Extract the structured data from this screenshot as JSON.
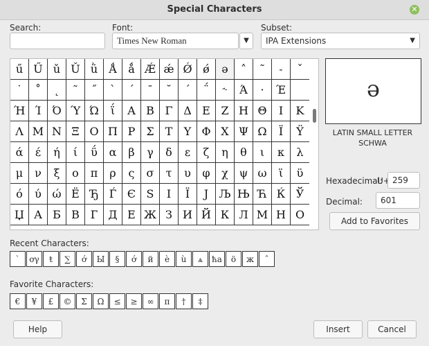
{
  "window": {
    "title": "Special Characters"
  },
  "search": {
    "label": "Search:",
    "value": ""
  },
  "font": {
    "label": "Font:",
    "value": "Times New Roman"
  },
  "subset": {
    "label": "Subset:",
    "value": "IPA Extensions"
  },
  "grid": {
    "cells": [
      "ű",
      "Ű",
      "ǔ",
      "Ǔ",
      "ǜ",
      "Ǻ",
      "ǻ",
      "Ǽ",
      "ǽ",
      "Ǿ",
      "ǿ",
      "ə",
      "˄",
      "˜",
      "˗",
      "ˇ",
      "˙",
      "˚",
      "˛",
      "˜",
      "˝",
      "ˋ",
      "ˊ",
      "ˉ",
      "˘",
      "΄",
      "΅",
      "˞",
      "Ά",
      "·",
      "Έ",
      "",
      "Ή",
      "Ί",
      "Ό",
      "Ύ",
      "Ώ",
      "ΐ",
      "Α",
      "Β",
      "Γ",
      "Δ",
      "Ε",
      "Ζ",
      "Η",
      "Θ",
      "Ι",
      "Κ",
      "Λ",
      "Μ",
      "Ν",
      "Ξ",
      "Ο",
      "Π",
      "Ρ",
      "Σ",
      "Τ",
      "Υ",
      "Φ",
      "Χ",
      "Ψ",
      "Ω",
      "Ϊ",
      "Ϋ",
      "ά",
      "έ",
      "ή",
      "ί",
      "ΰ",
      "α",
      "β",
      "γ",
      "δ",
      "ε",
      "ζ",
      "η",
      "θ",
      "ι",
      "κ",
      "λ",
      "μ",
      "ν",
      "ξ",
      "ο",
      "π",
      "ρ",
      "ς",
      "σ",
      "τ",
      "υ",
      "φ",
      "χ",
      "ψ",
      "ω",
      "ϊ",
      "ϋ",
      "ό",
      "ύ",
      "ώ",
      "Ё",
      "Ђ",
      "Ѓ",
      "Є",
      "Ѕ",
      "І",
      "Ї",
      "Ј",
      "Љ",
      "Њ",
      "Ћ",
      "Ќ",
      "Ў",
      "Џ",
      "А",
      "Б",
      "В",
      "Г",
      "Д",
      "Е",
      "Ж",
      "З",
      "И",
      "Й",
      "К",
      "Л",
      "М",
      "Н",
      "О"
    ]
  },
  "preview": {
    "glyph": "ə",
    "name": "LATIN SMALL LETTER SCHWA"
  },
  "hex": {
    "label": "Hexadecimal:",
    "prefix": "U+",
    "value": "259"
  },
  "dec": {
    "label": "Decimal:",
    "value": "601"
  },
  "buttons": {
    "add_fav": "Add to Favorites",
    "help": "Help",
    "insert": "Insert",
    "cancel": "Cancel"
  },
  "recent": {
    "label": "Recent Characters:",
    "items": [
      "ˋ",
      "ơγ",
      "ŧ",
      "∑",
      "ớ",
      "Ы",
      "§",
      "ớ",
      "й",
      "è",
      "ù",
      "ѧ",
      "ћа",
      "ö",
      "ж",
      "ˆ"
    ]
  },
  "favorites": {
    "label": "Favorite Characters:",
    "items": [
      "€",
      "¥",
      "£",
      "©",
      "Σ",
      "Ω",
      "≤",
      "≥",
      "∞",
      "π",
      "†",
      "‡"
    ]
  }
}
